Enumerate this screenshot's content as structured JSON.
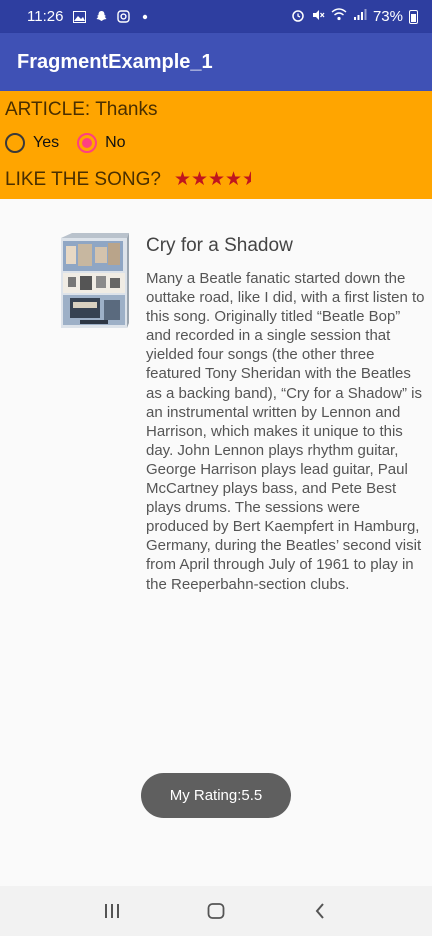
{
  "status_bar": {
    "time": "11:26",
    "battery": "73%",
    "left_icons": [
      "image-icon",
      "snapchat-icon",
      "instagram-icon",
      "dot-icon"
    ],
    "right_icons": [
      "alarm-icon",
      "mute-icon",
      "wifi-icon",
      "signal-icon",
      "battery-icon"
    ]
  },
  "app_bar": {
    "title": "FragmentExample_1"
  },
  "article": {
    "label": "ARTICLE:",
    "value": "Thanks"
  },
  "radio": {
    "options": [
      {
        "label": "Yes",
        "checked": false
      },
      {
        "label": "No",
        "checked": true
      }
    ]
  },
  "rating": {
    "label": "LIKE THE SONG?",
    "stars": 5,
    "value": 4.5
  },
  "song": {
    "title": "Cry for a Shadow",
    "body": "Many a Beatle fanatic started down the outtake road, like I did, with a first listen to this song. Originally titled “Beatle Bop” and recorded in a single session that yielded four songs (the other three featured Tony Sheridan with the Beatles as a backing band), “Cry for a Shadow” is an instrumental written by Lennon and Harrison, which makes it unique to this day. John Lennon plays rhythm guitar, George Harrison plays lead guitar, Paul McCartney plays bass, and Pete Best plays drums. The sessions were produced by Bert Kaempfert in Hamburg, Germany, during the Beatles’ second visit from April through July of 1961 to play in the Reeperbahn-section clubs."
  },
  "toast": {
    "text": "My Rating:5.5"
  },
  "colors": {
    "status_bar": "#2e3ea0",
    "app_bar": "#3f51b5",
    "panel": "#ffa500",
    "accent": "#ff4081",
    "star": "#c0161e"
  }
}
